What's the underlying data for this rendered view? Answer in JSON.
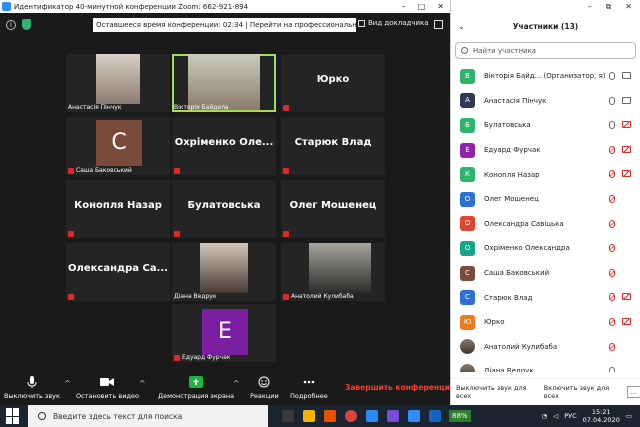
{
  "titlebar": {
    "title": "Идентификатор 40-минутной конференции Zoom: 662-921-894"
  },
  "topbar": {
    "banner": "Оставшееся время конференции: 02:34 | Перейти на профессиональный план",
    "speaker_view": "Вид докладчика"
  },
  "tiles": [
    {
      "name": "Анастасія Пінчук",
      "type": "photo",
      "muted": false
    },
    {
      "name": "Вікторія Байдала",
      "type": "photo",
      "muted": false,
      "active": true
    },
    {
      "name": "Юрко",
      "type": "text",
      "muted": true
    },
    {
      "name": "Саша Баковський",
      "type": "letter",
      "letter": "С",
      "color": "#7a4a3a",
      "muted": true
    },
    {
      "name": "Охріменко Оле...",
      "type": "text",
      "muted": true
    },
    {
      "name": "Старюк Влад",
      "type": "text",
      "muted": true
    },
    {
      "name": "Конопля Назар",
      "type": "text",
      "muted": true
    },
    {
      "name": "Булатовська",
      "type": "text",
      "muted": true
    },
    {
      "name": "Олег Мошенец",
      "type": "text",
      "muted": true
    },
    {
      "name": "Олександра Са...",
      "type": "text",
      "muted": true
    },
    {
      "name": "Діана Ведрук",
      "type": "photo",
      "muted": false
    },
    {
      "name": "Анатолий Кулибаба",
      "type": "photo",
      "muted": true
    },
    {
      "name": "Едуард Фурчак",
      "type": "letter",
      "letter": "Е",
      "color": "#7a1fa2",
      "muted": true
    }
  ],
  "toolbar": {
    "mute": "Выключить звук",
    "video": "Остановить видео",
    "share": "Демонстрация экрана",
    "reactions": "Реакции",
    "more": "Подробнее",
    "end": "Завершить конференцию"
  },
  "taskbar": {
    "search_placeholder": "Введите здесь текст для поиска",
    "battery": "88%",
    "lang": "РУС",
    "time": "15:21",
    "date": "07.04.2020"
  },
  "panel": {
    "title": "Участники (13)",
    "search_placeholder": "Найти участника",
    "participants": [
      {
        "name": "Вікторія Байд... (Организатор, я)",
        "letter": "В",
        "color": "#2fb56b",
        "mic_muted": false,
        "cam_off": false
      },
      {
        "name": "Анастасія Пінчук",
        "letter": "А",
        "color": "#2e3a57",
        "mic_muted": false,
        "cam_off": false
      },
      {
        "name": "Булатовська",
        "letter": "Б",
        "color": "#2fb56b",
        "mic_muted": false,
        "cam_off": true
      },
      {
        "name": "Едуард Фурчак",
        "letter": "Е",
        "color": "#8e24aa",
        "mic_muted": true,
        "cam_off": true
      },
      {
        "name": "Конопля Назар",
        "letter": "К",
        "color": "#2fb56b",
        "mic_muted": true,
        "cam_off": true
      },
      {
        "name": "Олег Мошенец",
        "letter": "О",
        "color": "#2c6fd6",
        "mic_muted": true,
        "cam_off": false
      },
      {
        "name": "Олександра Савіцька",
        "letter": "О",
        "color": "#e0452f",
        "mic_muted": true,
        "cam_off": false
      },
      {
        "name": "Охріменко Олександра",
        "letter": "О",
        "color": "#17a589",
        "mic_muted": true,
        "cam_off": false
      },
      {
        "name": "Саша Баковський",
        "letter": "С",
        "color": "#7a4a3a",
        "mic_muted": true,
        "cam_off": false
      },
      {
        "name": "Старюк Влад",
        "letter": "С",
        "color": "#2c6fd6",
        "mic_muted": true,
        "cam_off": true
      },
      {
        "name": "Юрко",
        "letter": "Ю",
        "color": "#f07b1e",
        "mic_muted": true,
        "cam_off": true
      },
      {
        "name": "Анатолий Кулибаба",
        "letter": "",
        "color": "",
        "photo": true,
        "mic_muted": true,
        "cam_off": false
      },
      {
        "name": "Діана Ведрук",
        "letter": "",
        "color": "",
        "photo": true,
        "mic_muted": false,
        "cam_off": false
      }
    ],
    "mute_all": "Выключить звук для всех",
    "unmute_all": "Включить звук для всех",
    "more_dots": "..."
  }
}
